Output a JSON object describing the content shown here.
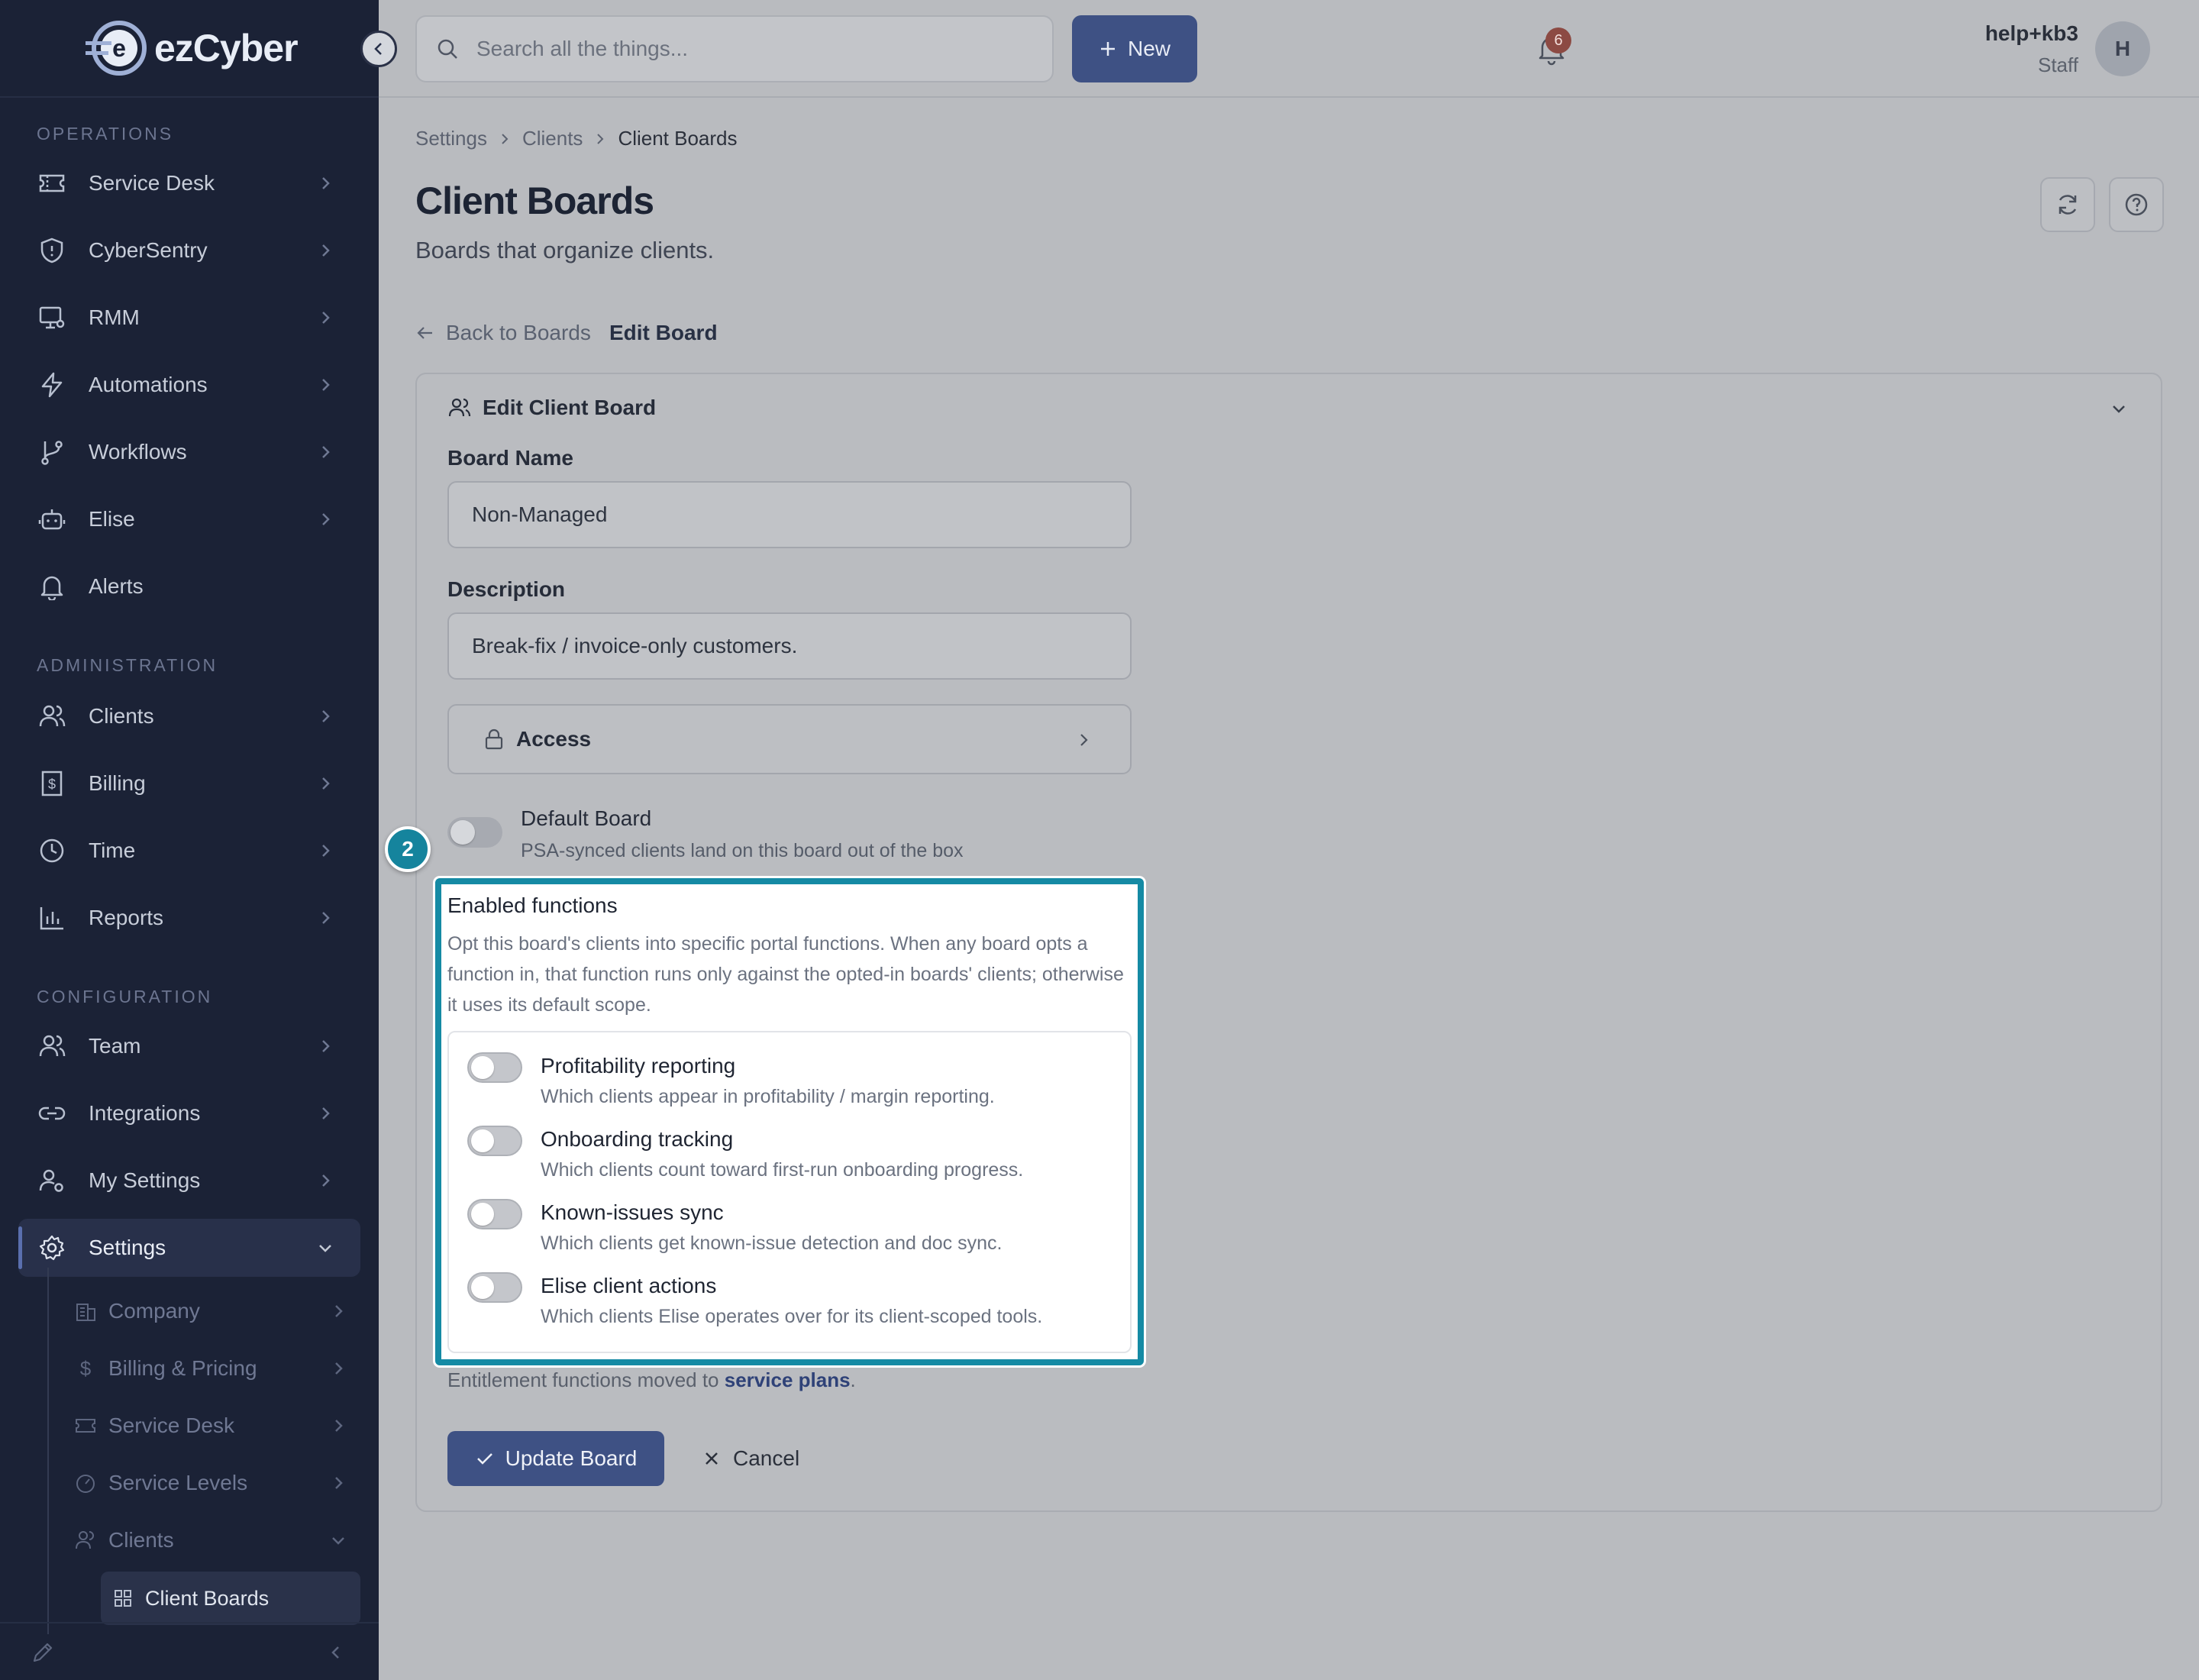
{
  "app": {
    "logo_text": "ezCyber"
  },
  "topbar": {
    "search_placeholder": "Search all the things...",
    "new_label": "New",
    "notification_count": "6",
    "user_name": "help+kb3",
    "user_role": "Staff",
    "avatar_initial": "H"
  },
  "sidebar": {
    "sections": {
      "operations": "OPERATIONS",
      "administration": "ADMINISTRATION",
      "configuration": "CONFIGURATION"
    },
    "items": {
      "service_desk": "Service Desk",
      "cybersentry": "CyberSentry",
      "rmm": "RMM",
      "automations": "Automations",
      "workflows": "Workflows",
      "elise": "Elise",
      "alerts": "Alerts",
      "clients": "Clients",
      "billing": "Billing",
      "time": "Time",
      "reports": "Reports",
      "team": "Team",
      "integrations": "Integrations",
      "my_settings": "My Settings",
      "settings": "Settings"
    },
    "sub_items": {
      "company": "Company",
      "billing_pricing": "Billing & Pricing",
      "service_desk": "Service Desk",
      "service_levels": "Service Levels",
      "clients": "Clients",
      "client_boards": "Client Boards"
    }
  },
  "breadcrumb": [
    "Settings",
    "Clients",
    "Client Boards"
  ],
  "page": {
    "title": "Client Boards",
    "subtitle": "Boards that organize clients.",
    "back_label": "Back to Boards",
    "edit_label": "Edit Board"
  },
  "form": {
    "card_title": "Edit Client Board",
    "board_name_label": "Board Name",
    "board_name_value": "Non-Managed",
    "description_label": "Description",
    "description_value": "Break-fix / invoice-only customers.",
    "access_label": "Access",
    "default_board_label": "Default Board",
    "default_board_desc": "PSA-synced clients land on this board out of the box",
    "default_board_enabled": false,
    "step_number": "2",
    "enabled_functions_title": "Enabled functions",
    "enabled_functions_desc": "Opt this board's clients into specific portal functions. When any board opts a function in, that function runs only against the opted-in boards' clients; otherwise it uses its default scope.",
    "functions": [
      {
        "name": "Profitability reporting",
        "desc": "Which clients appear in profitability / margin reporting.",
        "enabled": false
      },
      {
        "name": "Onboarding tracking",
        "desc": "Which clients count toward first-run onboarding progress.",
        "enabled": false
      },
      {
        "name": "Known-issues sync",
        "desc": "Which clients get known-issue detection and doc sync.",
        "enabled": false
      },
      {
        "name": "Elise client actions",
        "desc": "Which clients Elise operates over for its client-scoped tools.",
        "enabled": false
      }
    ],
    "entitlement_prefix": "Entitlement functions moved to",
    "entitlement_link": "service plans",
    "entitlement_suffix": ".",
    "update_label": "Update Board",
    "cancel_label": "Cancel"
  },
  "colors": {
    "accent": "#3e5184",
    "highlight": "#158aa4",
    "sidebar_bg": "#1b2236"
  }
}
